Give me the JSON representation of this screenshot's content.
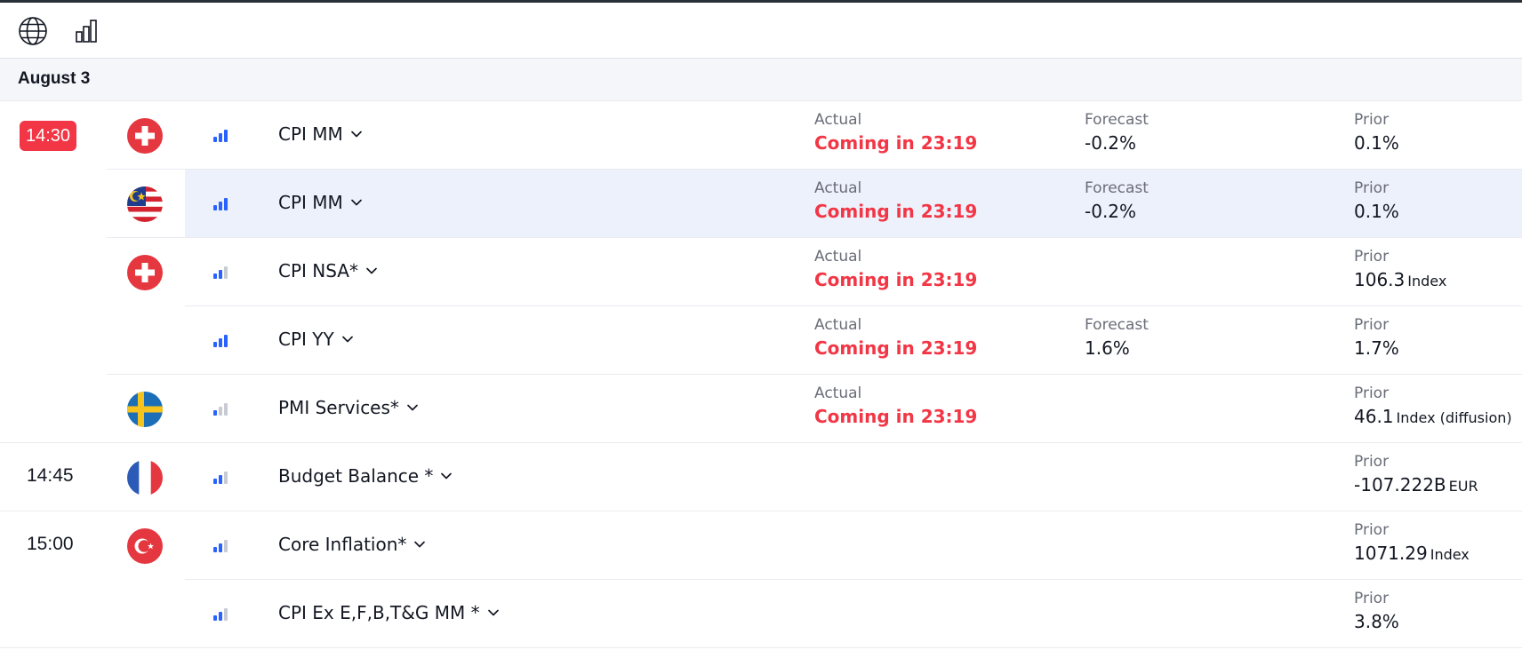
{
  "toolbar": {
    "icons": [
      "globe-icon",
      "bar-chart-icon"
    ]
  },
  "date_header": "August 3",
  "labels": {
    "actual": "Actual",
    "forecast": "Forecast",
    "prior": "Prior"
  },
  "colors": {
    "accent_red": "#f23645",
    "importance_on": "#2962ff",
    "importance_off": "#c9cbd3"
  },
  "events": [
    {
      "time": "14:30",
      "time_style": "badge",
      "flag": "switzerland",
      "importance": 3,
      "name": "CPI MM",
      "actual": "Coming in 23:19",
      "forecast": "-0.2%",
      "prior": "0.1%",
      "prior_unit": ""
    },
    {
      "time": "",
      "flag": "malaysia",
      "importance": 3,
      "name": "CPI MM",
      "actual": "Coming in 23:19",
      "forecast": "-0.2%",
      "prior": "0.1%",
      "prior_unit": "",
      "highlighted": true
    },
    {
      "time": "",
      "flag": "switzerland",
      "importance": 2,
      "name": "CPI NSA*",
      "actual": "Coming in 23:19",
      "forecast": "",
      "prior": "106.3",
      "prior_unit": "Index"
    },
    {
      "time": "",
      "flag": "",
      "importance": 3,
      "name": "CPI YY",
      "actual": "Coming in 23:19",
      "forecast": "1.6%",
      "prior": "1.7%",
      "prior_unit": ""
    },
    {
      "time": "",
      "flag": "sweden",
      "importance": 1,
      "name": "PMI Services*",
      "actual": "Coming in 23:19",
      "forecast": "",
      "prior": "46.1",
      "prior_unit": "Index (diffusion)"
    },
    {
      "time": "14:45",
      "flag": "france",
      "importance": 2,
      "name": "Budget Balance *",
      "actual": "",
      "forecast": "",
      "prior": "-107.222B",
      "prior_unit": "EUR"
    },
    {
      "time": "15:00",
      "flag": "turkey",
      "importance": 2,
      "name": "Core Inflation*",
      "actual": "",
      "forecast": "",
      "prior": "1071.29",
      "prior_unit": "Index"
    },
    {
      "time": "",
      "flag": "",
      "importance": 2,
      "name": "CPI Ex E,F,B,T&G MM *",
      "actual": "",
      "forecast": "",
      "prior": "3.8%",
      "prior_unit": ""
    }
  ]
}
